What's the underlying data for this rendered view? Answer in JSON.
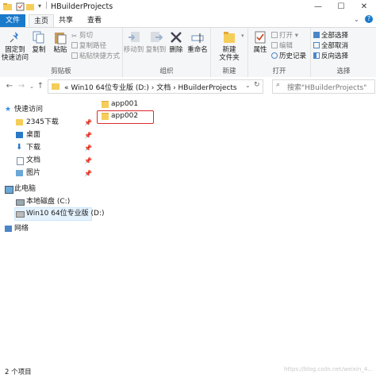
{
  "window": {
    "title": "HBuilderProjects",
    "minimize": "—",
    "maximize": "☐",
    "close": "✕"
  },
  "tabs": [
    "文件",
    "主页",
    "共享",
    "查看"
  ],
  "ribbon": {
    "clipboard": {
      "label": "剪贴板",
      "pin": "固定到\n快速访问",
      "copy": "复制",
      "paste": "粘贴",
      "cut": "剪切",
      "copy_path": "复制路径",
      "paste_shortcut": "粘贴快捷方式"
    },
    "organize": {
      "label": "组织",
      "move_to": "移动到",
      "copy_to": "复制到",
      "delete": "删除",
      "rename": "重命名"
    },
    "new": {
      "label": "新建",
      "new_folder": "新建\n文件夹"
    },
    "open": {
      "label": "打开",
      "properties": "属性",
      "open": "打开",
      "edit": "编辑",
      "history": "历史记录"
    },
    "select": {
      "label": "选择",
      "select_all": "全部选择",
      "select_none": "全部取消",
      "invert": "反向选择"
    }
  },
  "address": {
    "path": "«  Win10 64位专业版 (D:)  ›  文档  ›  HBuilderProjects",
    "search_placeholder": "搜索\"HBuilderProjects\""
  },
  "sidebar": {
    "quick_access": "快速访问",
    "items": [
      "2345下载",
      "桌面",
      "下载",
      "文档",
      "图片"
    ],
    "this_pc": "此电脑",
    "drive_c": "本地磁盘 (C:)",
    "drive_d": "Win10 64位专业版 (D:)",
    "network": "网络"
  },
  "files": [
    "app001",
    "app002"
  ],
  "status": {
    "count": "2 个项目",
    "watermark": "https://blog.csdn.net/weixin_4..."
  },
  "colors": {
    "accent": "#1979ca",
    "highlight_border": "#e02a2a",
    "folder": "#f5cd59"
  }
}
